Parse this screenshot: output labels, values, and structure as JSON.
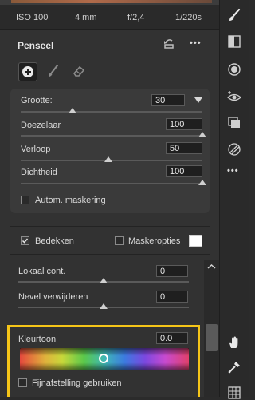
{
  "exif": {
    "iso": "ISO 100",
    "focal": "4 mm",
    "aperture": "f/2,4",
    "shutter": "1/220s"
  },
  "panel": {
    "title": "Penseel",
    "more_label": "•••",
    "brush": {
      "size": {
        "label": "Grootte:",
        "value": "30",
        "level": 0.3
      },
      "feather": {
        "label": "Doezelaar",
        "value": "100",
        "level": 1.0
      },
      "flow": {
        "label": "Verloop",
        "value": "50",
        "level": 0.5
      },
      "density": {
        "label": "Dichtheid",
        "value": "100",
        "level": 1.0
      },
      "auto_mask": {
        "label": "Autom. maskering",
        "checked": false
      }
    },
    "overlay": {
      "label": "Bedekken",
      "checked": true
    },
    "mask_options": {
      "label": "Maskeropties",
      "checked": false,
      "color": "#ffffff"
    }
  },
  "adjustments": {
    "local_contrast": {
      "label": "Lokaal cont.",
      "value": "0"
    },
    "dehaze": {
      "label": "Nevel verwijderen",
      "value": "0"
    },
    "hue": {
      "label": "Kleurtoon",
      "value": "0.0"
    },
    "fine_tune": {
      "label": "Fijnafstelling gebruiken",
      "checked": false
    }
  },
  "rail": {
    "more_label": "•••"
  },
  "colors": {
    "highlight": "#f5c518",
    "panel_bg": "#323232"
  }
}
